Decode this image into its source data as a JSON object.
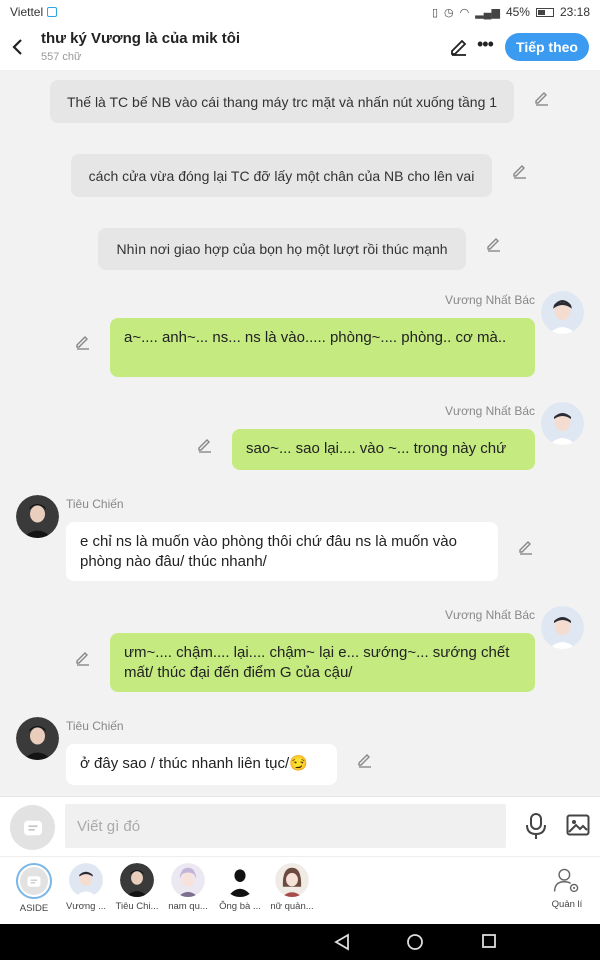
{
  "status_bar": {
    "carrier": "Viettel",
    "battery": "45%",
    "time": "23:18"
  },
  "header": {
    "title": "thư ký Vương là của mik tôi",
    "word_count": "557 chữ",
    "next_label": "Tiếp theo"
  },
  "messages": {
    "narration": [
      "Thế là TC bế NB vào cái thang máy trc mặt và nhấn nút xuống tầng 1",
      "cách cửa vừa đóng lại TC đỡ lấy một chân của NB cho lên vai",
      "Nhìn nơi giao hợp của bọn họ một lượt rồi thúc mạnh"
    ],
    "m1": {
      "sender": "Vương Nhất Bác",
      "text": "a~.... anh~... ns... ns là vào..... phòng~.... phòng.. cơ mà.."
    },
    "m2": {
      "sender": "Vương Nhất Bác",
      "text": "sao~... sao lại.... vào ~... trong này chứ"
    },
    "m3": {
      "sender": "Tiêu Chiến",
      "text": "e chỉ ns là muốn vào phòng thôi chứ đâu ns là muốn vào phòng nào đâu/ thúc nhanh/"
    },
    "m4": {
      "sender": "Vương Nhất Bác",
      "text": "ưm~.... chậm.... lại.... chậm~ lại e...  sướng~... sướng chết mất/ thúc đại đến điểm G của cậu/"
    },
    "m5": {
      "sender": "Tiêu Chiến",
      "text": "ở đây sao / thúc nhanh liên tục/😏"
    }
  },
  "input": {
    "placeholder": "Viết gì đó"
  },
  "characters": [
    {
      "label": "ASIDE"
    },
    {
      "label": "Vương ..."
    },
    {
      "label": "Tiêu Chi..."
    },
    {
      "label": "nam qu..."
    },
    {
      "label": "Ông bà ..."
    },
    {
      "label": "nữ quản..."
    },
    {
      "label": "Quản lí"
    }
  ],
  "colors": {
    "accent": "#3b9bf0",
    "my_bubble": "#c4ea80",
    "other_bubble": "#ffffff",
    "narration_bubble": "#e6e6e6"
  },
  "icons": [
    "back-icon",
    "pencil-icon",
    "more-icon",
    "mic-icon",
    "image-icon",
    "manage-icon",
    "nav-back-icon",
    "nav-home-icon",
    "nav-recents-icon"
  ]
}
